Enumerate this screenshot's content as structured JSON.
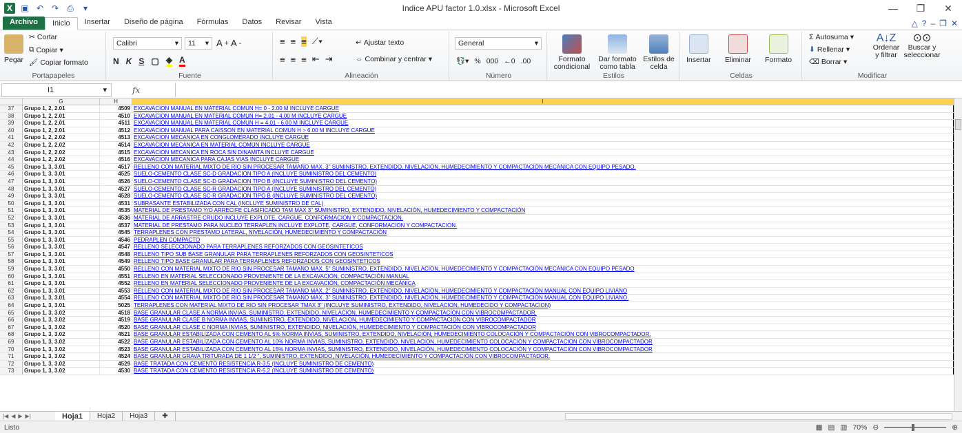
{
  "window": {
    "title": "Indice APU factor 1.0.xlsx - Microsoft Excel"
  },
  "tabs": [
    "Archivo",
    "Inicio",
    "Insertar",
    "Diseño de página",
    "Fórmulas",
    "Datos",
    "Revisar",
    "Vista"
  ],
  "ribbon": {
    "clipboard": {
      "paste": "Pegar",
      "cut": "Cortar",
      "copy": "Copiar",
      "format_painter": "Copiar formato",
      "group": "Portapapeles"
    },
    "font": {
      "name": "Calibri",
      "size": "11",
      "group": "Fuente"
    },
    "alignment": {
      "wrap": "Ajustar texto",
      "merge": "Combinar y centrar",
      "group": "Alineación"
    },
    "number": {
      "format": "General",
      "percent": "%",
      "thousands": "000",
      "group": "Número"
    },
    "styles": {
      "conditional": "Formato condicional",
      "as_table": "Dar formato como tabla",
      "cell_styles": "Estilos de celda",
      "group": "Estilos"
    },
    "cells": {
      "insert": "Insertar",
      "delete": "Eliminar",
      "format": "Formato",
      "group": "Celdas"
    },
    "editing": {
      "autosum": "Autosuma",
      "fill": "Rellenar",
      "clear": "Borrar",
      "sort": "Ordenar y filtrar",
      "find": "Buscar y seleccionar",
      "group": "Modificar"
    }
  },
  "formula_bar": {
    "name_box": "I1",
    "fx": "fx",
    "content": ""
  },
  "columns": [
    "G",
    "H",
    "I"
  ],
  "rows": [
    {
      "n": "37",
      "g": "Grupo 1, 2, 2.01",
      "h": "4509",
      "i": "EXCAVACION MANUAL EN MATERIAL COMUN H= 0 - 2.00 M INCLUYE CARGUE"
    },
    {
      "n": "38",
      "g": "Grupo 1, 2, 2.01",
      "h": "4510",
      "i": "EXCAVACION MANUAL EN MATERIAL COMUN H= 2.01 - 4.00 M INCLUYE CARGUE"
    },
    {
      "n": "39",
      "g": "Grupo 1, 2, 2.01",
      "h": "4511",
      "i": "EXCAVACION MANUAL EN MATERIAL COMUN H = 4.01 - 6.00 M INCLUYE CARGUE"
    },
    {
      "n": "40",
      "g": "Grupo 1, 2, 2.01",
      "h": "4512",
      "i": "EXCAVACION MANUAL PARA CAISSON EN MATERIAL COMUN H > 6.00 M INCLUYE CARGUE"
    },
    {
      "n": "41",
      "g": "Grupo 1, 2, 2.02",
      "h": "4513",
      "i": "EXCAVACION MECANICA EN CONGLOMERADO INCLUYE CARGUE"
    },
    {
      "n": "42",
      "g": "Grupo 1, 2, 2.02",
      "h": "4514",
      "i": "EXCAVACION MECANICA EN MATERIAL COMÚN INCLUYE CARGUE"
    },
    {
      "n": "43",
      "g": "Grupo 1, 2, 2.02",
      "h": "4515",
      "i": "EXCAVACION MECANICA EN ROCA SIN DINAMITA INCLUYE CARGUE"
    },
    {
      "n": "44",
      "g": "Grupo 1, 2, 2.02",
      "h": "4516",
      "i": "EXCAVACION MECANICA PARA CAJAS VIAS INCLUYE CARGUE"
    },
    {
      "n": "45",
      "g": "Grupo 1, 3, 3.01",
      "h": "4517",
      "i": "RELLENO CON MATERIAL MIXTO DE RÍO SIN PROCESAR TAMAÑO MAX. 3\" SUMINISTRO, EXTENDIDO, NIVELACIÓN, HUMEDECIMIENTO Y COMPACTACIÓN MECÁNICA CON EQUIPO PESADO."
    },
    {
      "n": "46",
      "g": "Grupo 1, 3, 3.01",
      "h": "4525",
      "i": "SUELO-CEMENTO CLASE SC-D GRADACION TIPO A (INCLUYE SUMINISTRO DEL CEMENTO)"
    },
    {
      "n": "47",
      "g": "Grupo 1, 3, 3.01",
      "h": "4526",
      "i": "SUELO-CEMENTO CLASE SC-D GRADACION TIPO B (INCLUYE SUMINISTRO DEL CEMENTO)"
    },
    {
      "n": "48",
      "g": "Grupo 1, 3, 3.01",
      "h": "4527",
      "i": "SUELO-CEMENTO CLASE SC-R GRADACION TIPO A (INCLUYE SUMINISTRO DEL CEMENTO)"
    },
    {
      "n": "49",
      "g": "Grupo 1, 3, 3.01",
      "h": "4528",
      "i": "SUELO-CEMENTO CLASE SC-R GRADACION TIPO B (INCLUYE SUMINISTRO DEL CEMENTO)"
    },
    {
      "n": "50",
      "g": "Grupo 1, 3, 3.01",
      "h": "4531",
      "i": "SUBRASANTE ESTABILIZADA CON CAL (INCLUYE SUMINISTRO DE CAL)"
    },
    {
      "n": "51",
      "g": "Grupo 1, 3, 3.01",
      "h": "4535",
      "i": "MATERIAL DE PRESTAMO Y/O ARRECIFE CLASIFICADO TAM MAX 3\" SUMINISTRO, EXTENDIDO, NIVELACIÓN, HUMEDECIMIENTO Y COMPACTACIÓN"
    },
    {
      "n": "52",
      "g": "Grupo 1, 3, 3.01",
      "h": "4536",
      "i": "MATERIAL DE ARRASTRE CRUDO INCLUYE EXPLOTE, CARGUE, CONFORMACION Y COMPACTACION."
    },
    {
      "n": "53",
      "g": "Grupo 1, 3, 3.01",
      "h": "4537",
      "i": "MATERIAL DE PRESTAMO PARA NUCLEO TERRAPLEN INCLUYE EXPLOTE, CARGUE, CONFORMACION Y COMPACTACION."
    },
    {
      "n": "54",
      "g": "Grupo 1, 3, 3.01",
      "h": "4545",
      "i": "TERRAPLENES CON PRESTAMO LATERAL, NIVELACIÓN, HUMEDECIMIENTO Y COMPACTACIÓN"
    },
    {
      "n": "55",
      "g": "Grupo 1, 3, 3.01",
      "h": "4546",
      "i": "PEDRAPLEN COMPACTO"
    },
    {
      "n": "56",
      "g": "Grupo 1, 3, 3.01",
      "h": "4547",
      "i": "RELLENO SELECCIONADO PARA TERRAPLENES REFORZADOS CON GEOSINTETICOS"
    },
    {
      "n": "57",
      "g": "Grupo 1, 3, 3.01",
      "h": "4548",
      "i": "RELLENO TIPO SUB BASE GRANULAR PARA TERRAPLENES REFORZADOS CON GEOSINTETICOS"
    },
    {
      "n": "58",
      "g": "Grupo 1, 3, 3.01",
      "h": "4549",
      "i": "RELLENO TIPO BASE GRANULAR PARA TERRAPLENES REFORZADOS CON GEOSINTETICOS"
    },
    {
      "n": "59",
      "g": "Grupo 1, 3, 3.01",
      "h": "4550",
      "i": "RELLENO CON MATERIAL MIXTO DE RÍO SIN PROCESAR TAMAÑO MAX. 5\" SUMINISTRO, EXTENDIDO, NIVELACIÓN, HUMEDECIMIENTO Y COMPACTACIÓN MECÁNICA CON EQUIPO PESADO"
    },
    {
      "n": "60",
      "g": "Grupo 1, 3, 3.01",
      "h": "4551",
      "i": "RELLENO EN MATERIAL SELECCIONADO PROVENIENTE DE LA EXCAVACIÓN, COMPACTACIÓN MANUAL"
    },
    {
      "n": "61",
      "g": "Grupo 1, 3, 3.01",
      "h": "4552",
      "i": "RELLENO EN MATERIAL SELECCIONADO PROVENIENTE DE LA EXCAVACIÓN, COMPACTACIÓN MECÁNICA"
    },
    {
      "n": "62",
      "g": "Grupo 1, 3, 3.01",
      "h": "4553",
      "i": "RELLENO CON MATERIAL MIXTO DE RÍO SIN PROCESAR TAMAÑO MAX. 2\" SUMINISTRO, EXTENDIDO, NIVELACIÓN, HUMEDECIMIENTO Y COMPACTACIÓN MANUAL CON EQUIPO LIVIANO"
    },
    {
      "n": "63",
      "g": "Grupo 1, 3, 3.01",
      "h": "4554",
      "i": "RELLENO CON MATERIAL MIXTO DE RÍO SIN PROCESAR TAMAÑO MAX. 3\" SUMINISTRO, EXTENDIDO, NIVELACIÓN, HUMEDECIMIENTO Y COMPACTACIÓN MANUAL CON EQUIPO LIVIANO."
    },
    {
      "n": "64",
      "g": "Grupo 1, 3, 3.01",
      "h": "5025",
      "i": "TERRAPLENES CON MATERIAL MIXTO DE RIO SIN PROCESAR TMAX 3\" (INCLUYE SUMINISTRO, EXTENDIDO, NIVELACION, HUMEDECIDO Y COMPACTACION)"
    },
    {
      "n": "65",
      "g": "Grupo 1, 3, 3.02",
      "h": "4518",
      "i": "BASE GRANULAR CLASE A NORMA INVIAS, SUMINISTRO, EXTENDIDO, NIVELACIÓN, HUMEDECIMIENTO Y COMPACTACIÓN CON VIBROCOMPACTADOR."
    },
    {
      "n": "66",
      "g": "Grupo 1, 3, 3.02",
      "h": "4519",
      "i": "BASE GRANULAR CLASE B NORMA INVIAS, SUMINISTRO, EXTENDIDO, NIVELACIÓN, HUMEDECIMIENTO Y COMPACTACIÓN CON VIBROCOMPACTADOR"
    },
    {
      "n": "67",
      "g": "Grupo 1, 3, 3.02",
      "h": "4520",
      "i": "BASE GRANULAR CLASE C NORMA INVIAS, SUMINISTRO, EXTENDIDO, NIVELACIÓN, HUMEDECIMIENTO Y COMPACTACIÓN CON VIBROCOMPACTADOR"
    },
    {
      "n": "68",
      "g": "Grupo 1, 3, 3.02",
      "h": "4521",
      "i": "BASE GRANULAR ESTABILIZADA CON CEMENTO AL 5% NORMA INVIAS, SUMINISTRO, EXTENDIDO, NIVELACIÓN, HUMEDECIMIENTO COLOCACIÓN Y COMPACTACIÓN CON VIBROCOMPACTADOR."
    },
    {
      "n": "69",
      "g": "Grupo 1, 3, 3.02",
      "h": "4522",
      "i": "BASE GRANULAR ESTABILIZADA CON CEMENTO AL 10% NORMA INVIAS, SUMINISTRO, EXTENDIDO, NIVELACIÓN, HUMEDECIMIENTO COLOCACIÓN Y COMPACTACIÓN CON VIBROCOMPACTADOR"
    },
    {
      "n": "70",
      "g": "Grupo 1, 3, 3.02",
      "h": "4523",
      "i": "BASE GRANULAR ESTABILIZADA CON CEMENTO AL 15% NORMA INVIAS, SUMINISTRO, EXTENDIDO, NIVELACIÓN, HUMEDECIMIENTO COLOCACIÓN Y COMPACTACIÓN CON VIBROCOMPACTADOR"
    },
    {
      "n": "71",
      "g": "Grupo 1, 3, 3.02",
      "h": "4524",
      "i": "BASE GRANULAR GRAVA TRITURADA DE 1 1/2 \", SUMINISTRO, EXTENDIDO, NIVELACIÓN, HUMEDECIMIENTO Y COMPACTACIÓN CON VIBROCOMPACTADOR."
    },
    {
      "n": "72",
      "g": "Grupo 1, 3, 3.02",
      "h": "4529",
      "i": "BASE TRATADA CON CEMENTO RESISTENCIA R-3.5 (INCLUYE SUMINISTRO DE CEMENTO)"
    },
    {
      "n": "73",
      "g": "Grupo 1, 3, 3.02",
      "h": "4530",
      "i": "BASE TRATADA CON CEMENTO RESISTENCIA R-5.2 (INCLUYE SUMINISTRO DE CEMENTO)"
    }
  ],
  "sheets": [
    "Hoja1",
    "Hoja2",
    "Hoja3"
  ],
  "status": {
    "ready": "Listo",
    "zoom": "70%"
  }
}
